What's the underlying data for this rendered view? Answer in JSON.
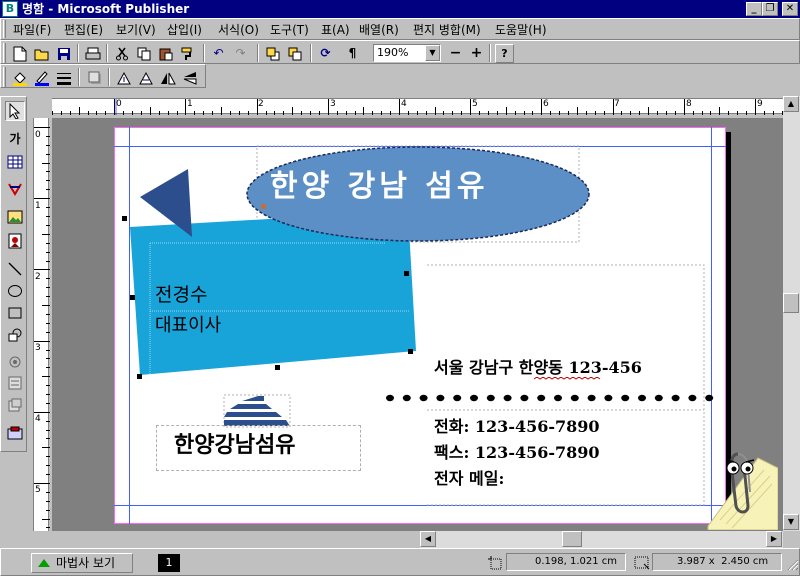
{
  "window": {
    "title": "명함 - Microsoft Publisher",
    "app_icon_label": "B",
    "controls": {
      "minimize": "_",
      "restore": "❐",
      "close": "✕"
    }
  },
  "menu": {
    "items": [
      "파일(F)",
      "편집(E)",
      "보기(V)",
      "삽입(I)",
      "서식(O)",
      "도구(T)",
      "표(A)",
      "배열(R)",
      "편지 병합(M)",
      "도움말(H)"
    ]
  },
  "standard_toolbar": {
    "zoom_value": "190%",
    "zoom_out_label": "−",
    "zoom_in_label": "+",
    "pilcrow_label": "¶",
    "help_label": "?"
  },
  "tools": {
    "text_frame_label": "가"
  },
  "rulers": {
    "horizontal_labels": [
      "0",
      "1",
      "2",
      "3",
      "4",
      "5",
      "6",
      "7",
      "8",
      "9"
    ],
    "vertical_labels": [
      "0",
      "1",
      "2",
      "3",
      "4",
      "5"
    ]
  },
  "card": {
    "company_banner": "한양 강남 섬유",
    "person_name": "전경수",
    "person_title": "대표이사",
    "logo_text": "한양강남섬유",
    "address": "서울 강남구 한양동 123-456",
    "phone": "전화: 123-456-7890",
    "fax": "팩스: 123-456-7890",
    "email": "전자 메일:",
    "colors": {
      "banner_ellipse": "#5b8fc6",
      "blue_panel": "#19a4d9",
      "triangle": "#2c4e8c",
      "logo_stripes": "#2c4e8c"
    }
  },
  "status": {
    "wizard_button": "마법사 보기",
    "page_number": "1",
    "position": "0.198, 1.021 cm",
    "size": "3.987 x  2.450 cm"
  }
}
